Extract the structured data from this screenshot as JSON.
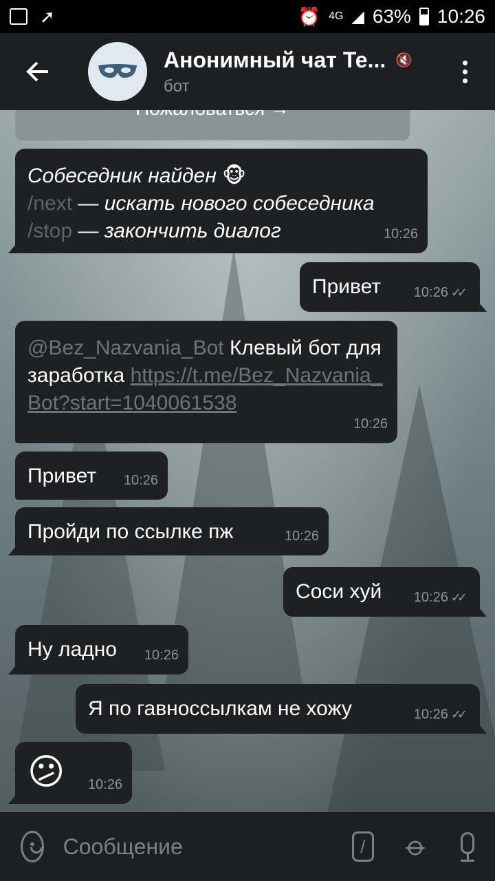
{
  "status_bar": {
    "battery": "63%",
    "time": "10:26",
    "network": "4G"
  },
  "header": {
    "back_icon": "arrow-left-icon",
    "title": "Анонимный чат Те...",
    "subtitle": "бот",
    "muted_icon": "mute-icon",
    "menu_icon": "more-vertical-icon"
  },
  "colors": {
    "bubble": "#1f2022",
    "header": "#1e1f21",
    "secondary_text": "#8d9296",
    "avatar_bg": "#dfe9ef"
  },
  "report_button": {
    "label": "Пожаловаться →"
  },
  "messages": [
    {
      "direction": "in",
      "line1": "Собеседник найден",
      "line1_emoji": "🐵",
      "cmd_next": "/next",
      "text_next": " — искать нового собеседника",
      "cmd_stop": "/stop",
      "text_stop": " — закончить диалог",
      "time": "10:26"
    },
    {
      "direction": "out",
      "text": "Привет",
      "time": "10:26",
      "check": "✓✓"
    },
    {
      "direction": "in",
      "mention": "@Bez_Nazvania_Bot",
      "text": " Клевый бот для заработка ",
      "link": "https://t.me/Bez_Nazvania_Bot?start=1040061538",
      "time": "10:26"
    },
    {
      "direction": "in",
      "text": "Привет",
      "time": "10:26"
    },
    {
      "direction": "in",
      "text": "Пройди по ссылке пж",
      "time": "10:26"
    },
    {
      "direction": "out",
      "text": "Соси хуй",
      "time": "10:26",
      "check": "✓✓"
    },
    {
      "direction": "in",
      "text": "Ну ладно",
      "time": "10:26"
    },
    {
      "direction": "out",
      "text": "Я по гавноссылкам не хожу",
      "time": "10:26",
      "check": "✓✓"
    },
    {
      "direction": "in",
      "text": "😕",
      "time": "10:26"
    }
  ],
  "input": {
    "placeholder": "Сообщение",
    "bot_command_icon": "/"
  }
}
